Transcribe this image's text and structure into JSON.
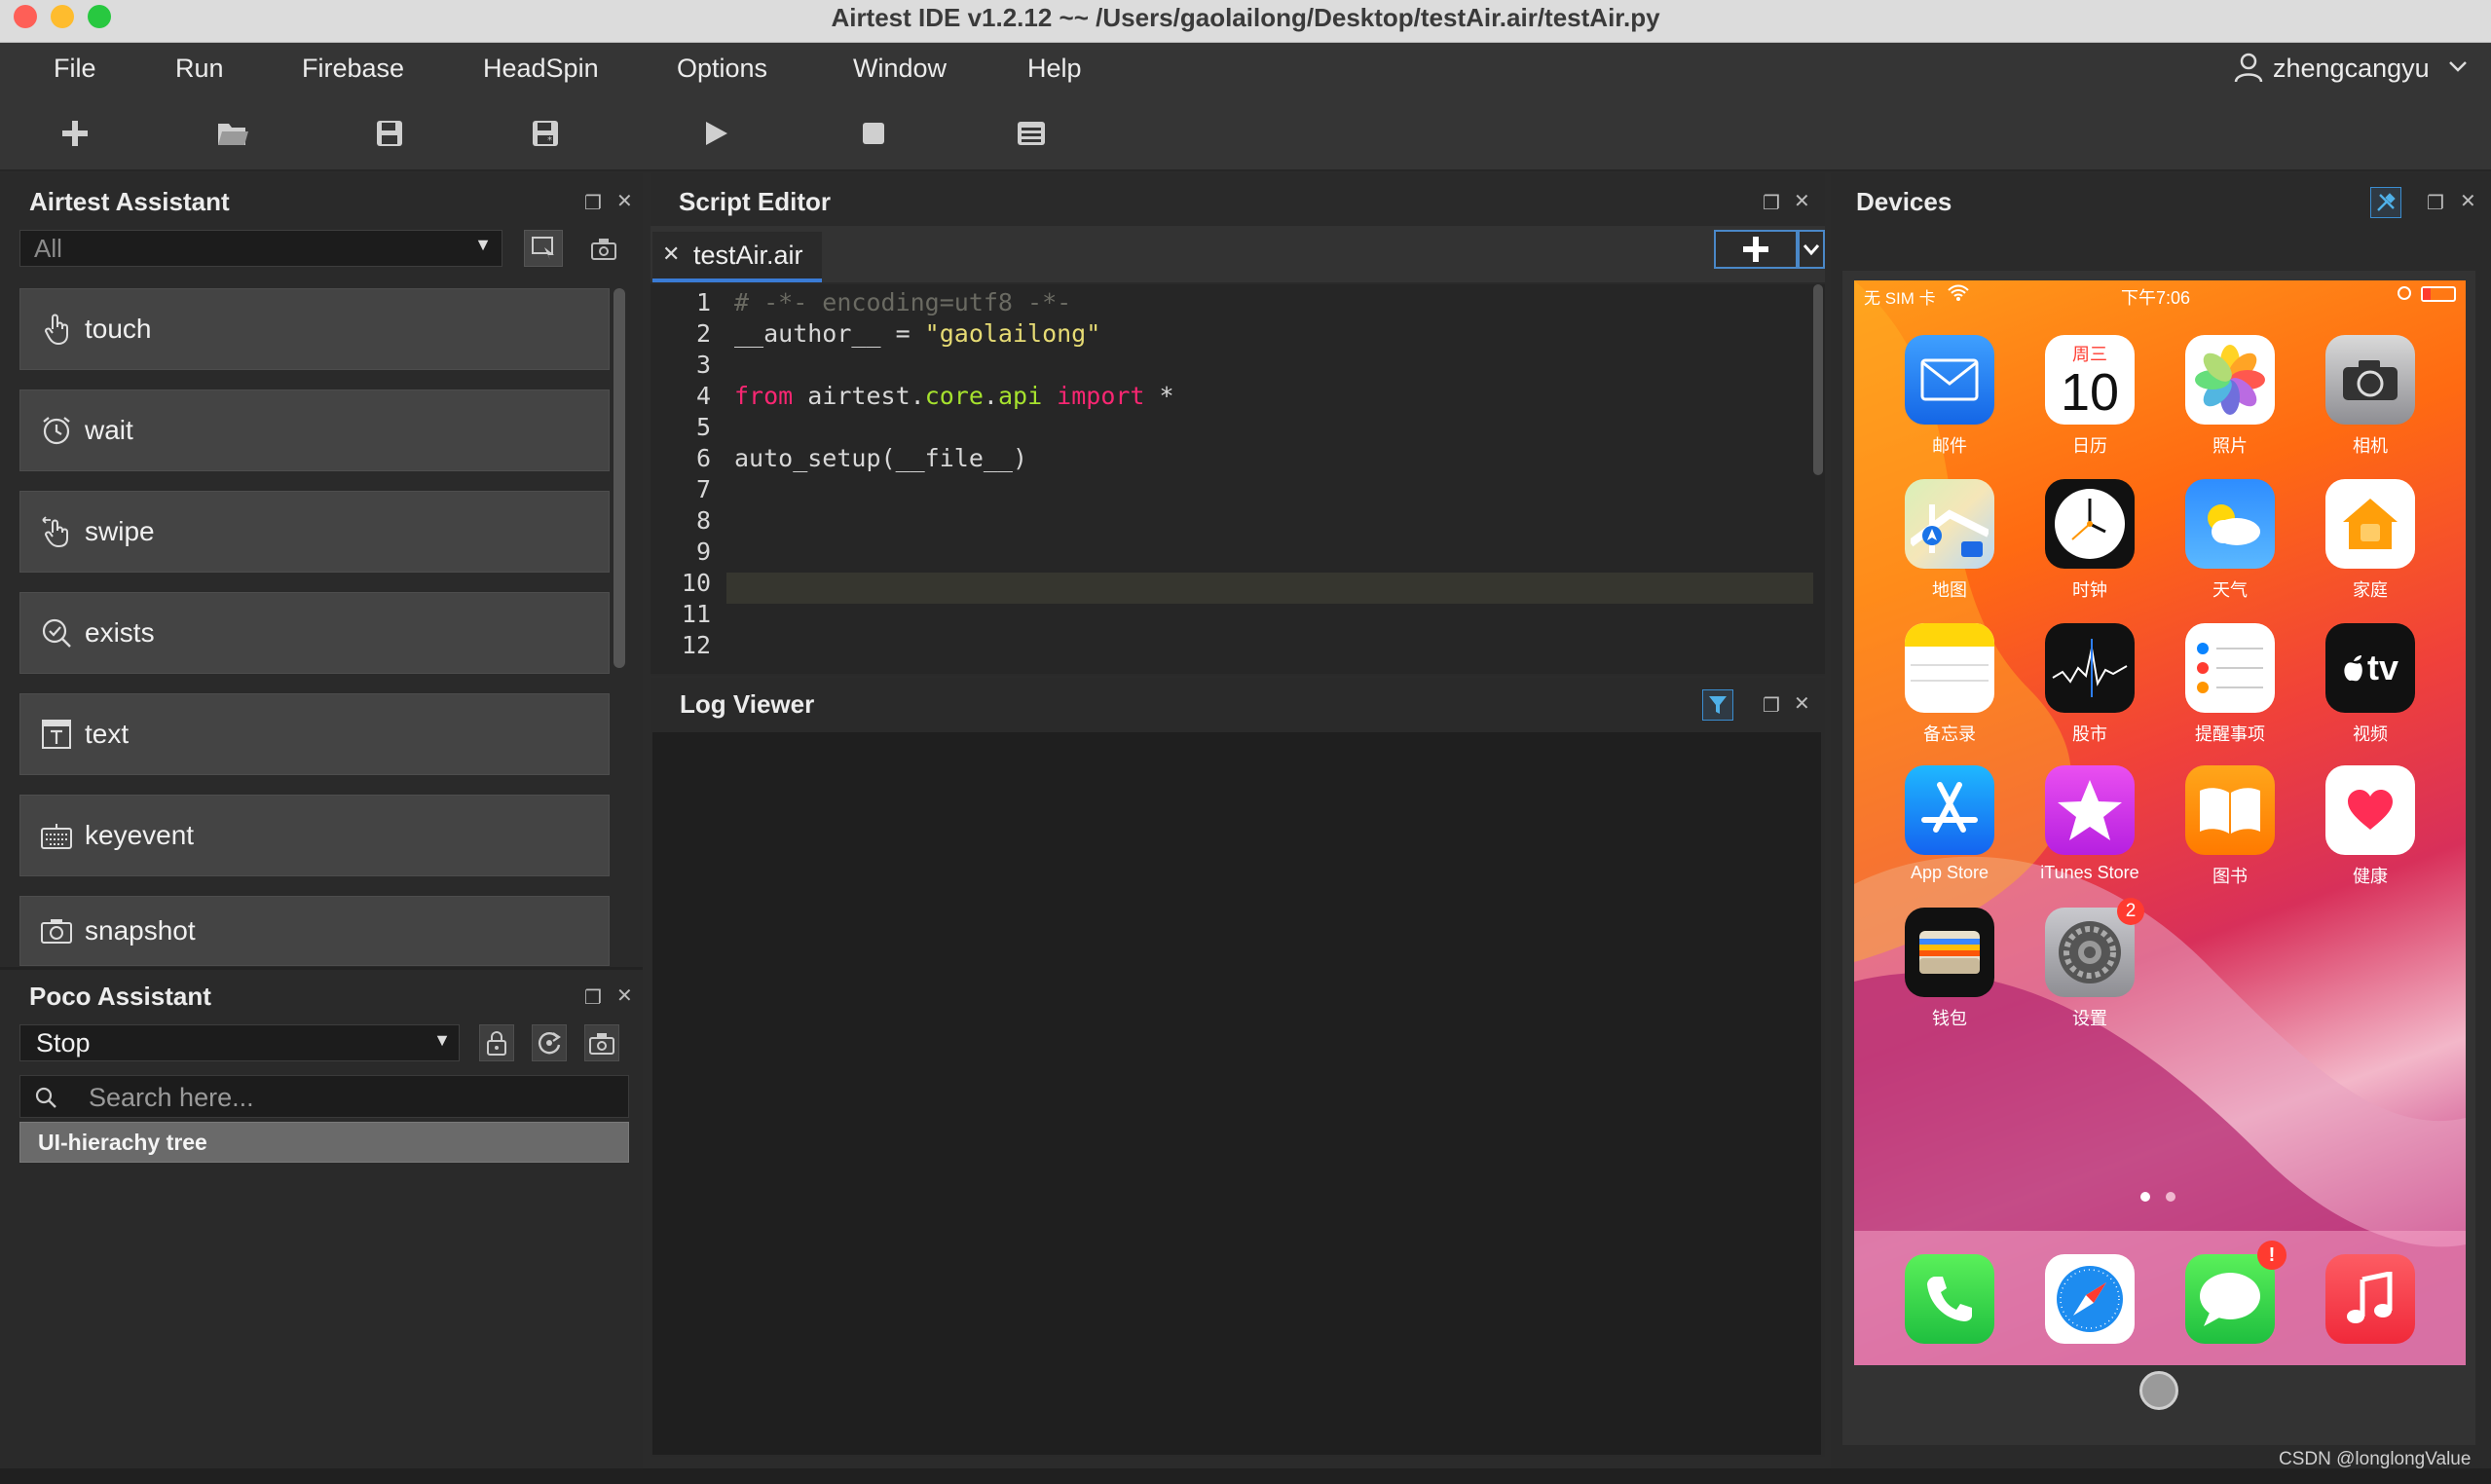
{
  "window": {
    "title": "Airtest IDE v1.2.12 ~~ /Users/gaolailong/Desktop/testAir.air/testAir.py"
  },
  "menu": {
    "items": [
      "File",
      "Run",
      "Firebase",
      "HeadSpin",
      "Options",
      "Window",
      "Help"
    ],
    "user": "zhengcangyu"
  },
  "toolbar": {
    "icons": [
      "plus-icon",
      "open-folder-icon",
      "save-icon",
      "save-as-icon",
      "run-icon",
      "stop-icon",
      "log-icon"
    ]
  },
  "airtest_assistant": {
    "title": "Airtest Assistant",
    "filter": "All",
    "actions": [
      "touch",
      "wait",
      "swipe",
      "exists",
      "text",
      "keyevent",
      "snapshot"
    ]
  },
  "poco_assistant": {
    "title": "Poco Assistant",
    "mode": "Stop",
    "search_placeholder": "Search here...",
    "tree_label": "UI-hierachy tree"
  },
  "script_editor": {
    "title": "Script Editor",
    "tab": "testAir.air",
    "line_numbers": [
      "1",
      "2",
      "3",
      "4",
      "5",
      "6",
      "7",
      "8",
      "9",
      "10",
      "11",
      "12"
    ],
    "lines": {
      "l1": "# -*- encoding=utf8 -*-",
      "l2_a": "__author__ = ",
      "l2_b": "\"gaolailong\"",
      "l4_from": "from",
      "l4_mod1": " airtest.",
      "l4_mod2": "core",
      "l4_mod3": ".",
      "l4_mod4": "api",
      "l4_import": " import",
      "l4_star": " *",
      "l6": "auto_setup(__file__)"
    }
  },
  "log_viewer": {
    "title": "Log Viewer"
  },
  "devices": {
    "title": "Devices",
    "status": {
      "carrier": "无 SIM 卡",
      "time": "下午7:06"
    },
    "calendar": {
      "weekday": "周三",
      "day": "10"
    },
    "apps": [
      {
        "label": "邮件"
      },
      {
        "label": "日历"
      },
      {
        "label": "照片"
      },
      {
        "label": "相机"
      },
      {
        "label": "地图"
      },
      {
        "label": "时钟"
      },
      {
        "label": "天气"
      },
      {
        "label": "家庭"
      },
      {
        "label": "备忘录"
      },
      {
        "label": "股市"
      },
      {
        "label": "提醒事项"
      },
      {
        "label": "视频"
      },
      {
        "label": "App Store"
      },
      {
        "label": "iTunes Store"
      },
      {
        "label": "图书"
      },
      {
        "label": "健康"
      },
      {
        "label": "钱包"
      },
      {
        "label": "设置"
      }
    ],
    "settings_badge": "2",
    "messages_badge": "!",
    "tv_text": "tv",
    "dock": [
      "phone-icon",
      "safari-icon",
      "messages-icon",
      "music-icon"
    ]
  },
  "watermark": "CSDN @longlongValue"
}
